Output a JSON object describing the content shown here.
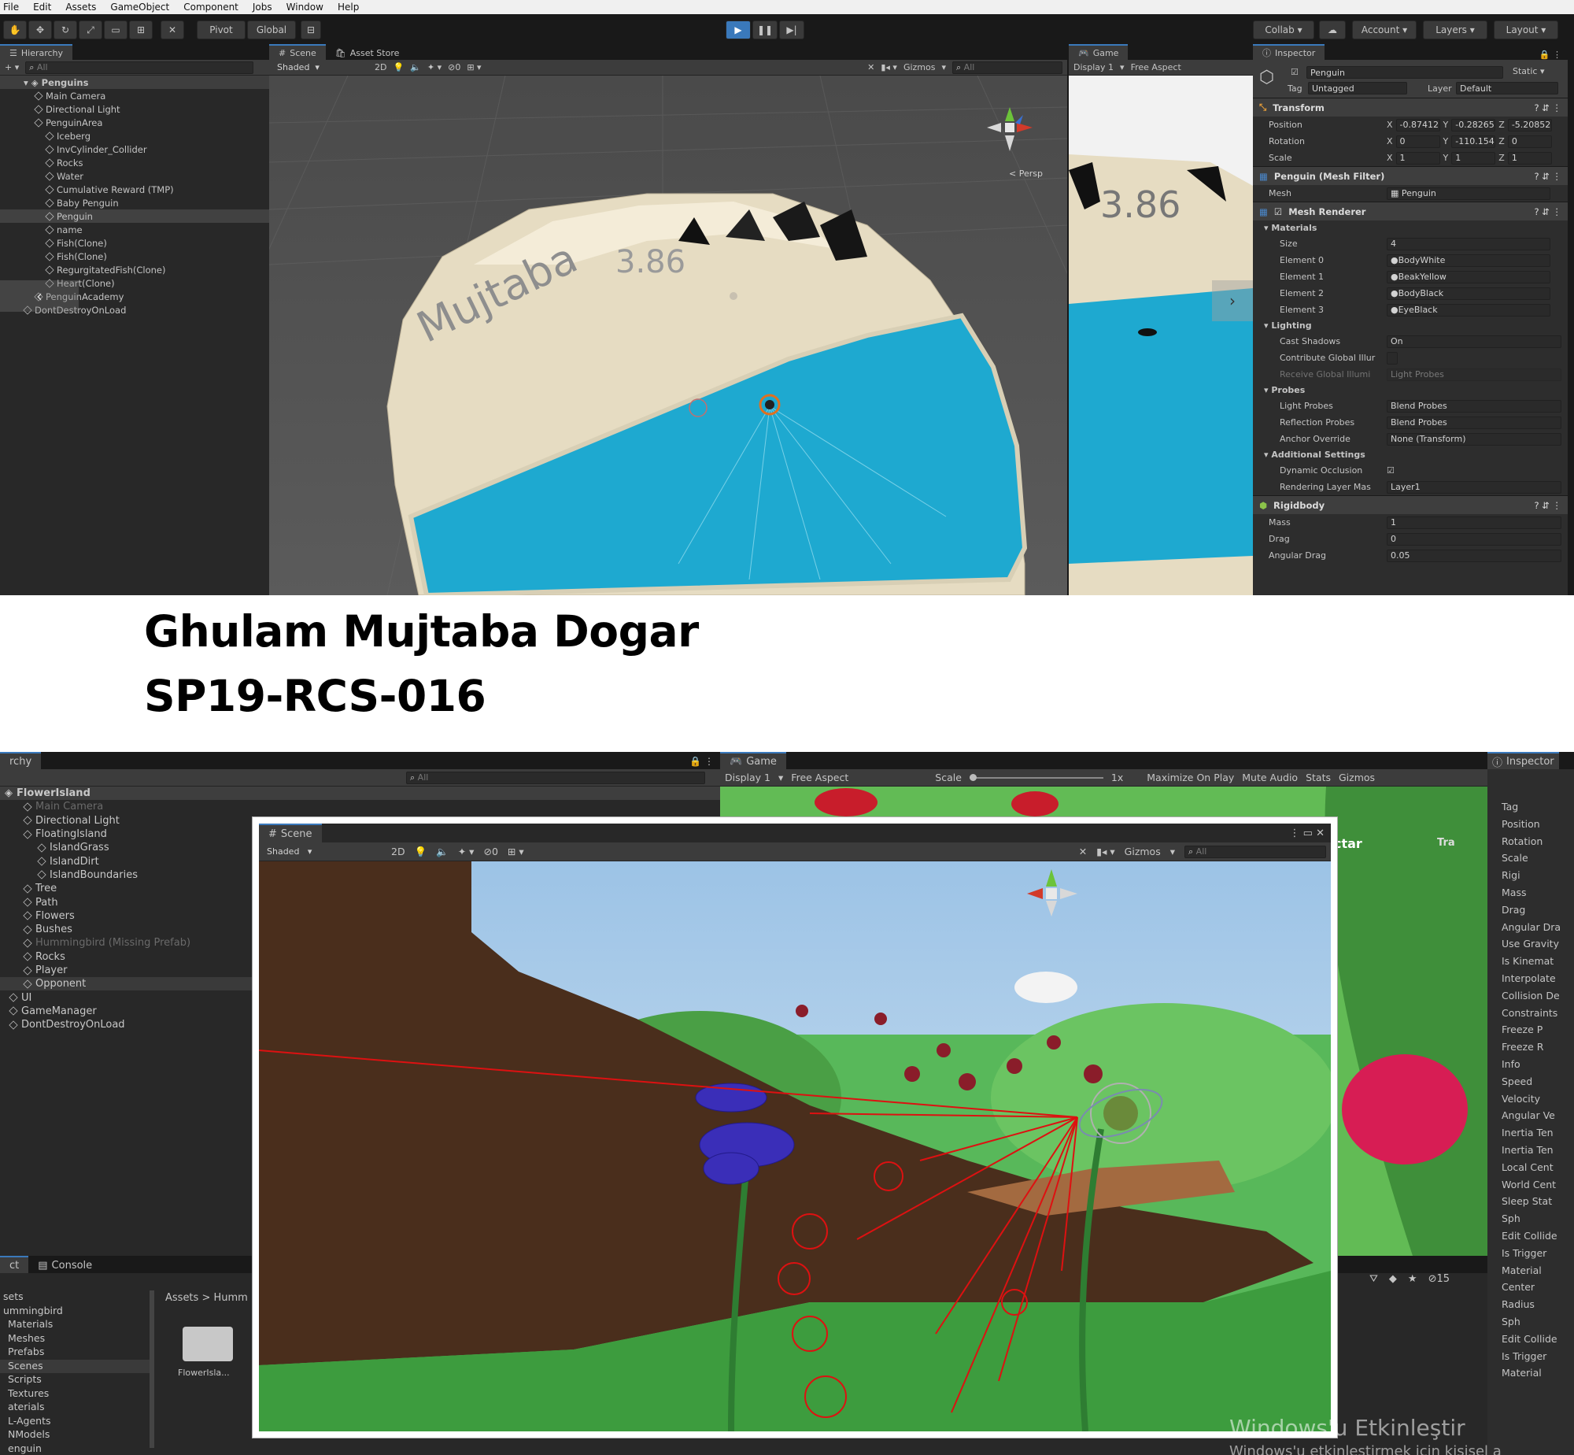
{
  "menu": [
    "File",
    "Edit",
    "Assets",
    "GameObject",
    "Component",
    "Jobs",
    "Window",
    "Help"
  ],
  "toolbar": {
    "pivot": "Pivot",
    "global": "Global",
    "collab": "Collab ▾",
    "account": "Account",
    "layers": "Layers",
    "layout": "Layout"
  },
  "top": {
    "hierarchy": {
      "tab": "Hierarchy",
      "search_placeholder": "All",
      "scene_name": "Penguins",
      "items": [
        {
          "label": "Main Camera",
          "indent": 2
        },
        {
          "label": "Directional Light",
          "indent": 2
        },
        {
          "label": "PenguinArea",
          "indent": 2
        },
        {
          "label": "Iceberg",
          "indent": 3
        },
        {
          "label": "InvCylinder_Collider",
          "indent": 3
        },
        {
          "label": "Rocks",
          "indent": 3
        },
        {
          "label": "Water",
          "indent": 3
        },
        {
          "label": "Cumulative Reward (TMP)",
          "indent": 3
        },
        {
          "label": "Baby Penguin",
          "indent": 3
        },
        {
          "label": "Penguin",
          "indent": 3
        },
        {
          "label": "name",
          "indent": 3
        },
        {
          "label": "Fish(Clone)",
          "indent": 3
        },
        {
          "label": "Fish(Clone)",
          "indent": 3
        },
        {
          "label": "RegurgitatedFish(Clone)",
          "indent": 3
        },
        {
          "label": "Heart(Clone)",
          "indent": 3
        },
        {
          "label": "PenguinAcademy",
          "indent": 2
        },
        {
          "label": "DontDestroyOnLoad",
          "indent": 1
        }
      ]
    },
    "scene": {
      "tab_scene": "Scene",
      "tab_store": "Asset Store",
      "shading": "Shaded",
      "mode_2d": "2D",
      "gizmos": "Gizmos",
      "search_placeholder": "All",
      "persp": "< Persp",
      "name_text": "Mujtaba",
      "reward_text": "3.86"
    },
    "game": {
      "tab": "Game",
      "display": "Display 1",
      "aspect": "Free Aspect",
      "reward_text": "3.86"
    },
    "inspector": {
      "tab": "Inspector",
      "object_name": "Penguin",
      "static_label": "Static ▾",
      "tag_label": "Tag",
      "tag_value": "Untagged",
      "layer_label": "Layer",
      "layer_value": "Default",
      "transform": {
        "title": "Transform",
        "position": {
          "label": "Position",
          "x": "-0.87412",
          "y": "-0.28265",
          "z": "-5.20852"
        },
        "rotation": {
          "label": "Rotation",
          "x": "0",
          "y": "-110.154",
          "z": "0"
        },
        "scale": {
          "label": "Scale",
          "x": "1",
          "y": "1",
          "z": "1"
        }
      },
      "mesh_filter": {
        "title": "Penguin (Mesh Filter)",
        "mesh_label": "Mesh",
        "mesh_value": "Penguin"
      },
      "mesh_renderer": {
        "title": "Mesh Renderer",
        "materials_header": "Materials",
        "size_label": "Size",
        "size_value": "4",
        "elements": [
          {
            "label": "Element 0",
            "value": "BodyWhite"
          },
          {
            "label": "Element 1",
            "value": "BeakYellow"
          },
          {
            "label": "Element 2",
            "value": "BodyBlack"
          },
          {
            "label": "Element 3",
            "value": "EyeBlack"
          }
        ],
        "lighting_header": "Lighting",
        "cast_shadows_label": "Cast Shadows",
        "cast_shadows_value": "On",
        "contribute_gi_label": "Contribute Global Illur",
        "receive_gi_label": "Receive Global Illumi",
        "receive_gi_value": "Light Probes",
        "probes_header": "Probes",
        "light_probes_label": "Light Probes",
        "light_probes_value": "Blend Probes",
        "reflection_probes_label": "Reflection Probes",
        "reflection_probes_value": "Blend Probes",
        "anchor_override_label": "Anchor Override",
        "anchor_override_value": "None (Transform)",
        "additional_header": "Additional Settings",
        "dynamic_occlusion_label": "Dynamic Occlusion",
        "rendering_layer_label": "Rendering Layer Mas",
        "rendering_layer_value": "Layer1"
      },
      "rigidbody": {
        "title": "Rigidbody",
        "mass_label": "Mass",
        "mass_value": "1",
        "drag_label": "Drag",
        "drag_value": "0",
        "angular_drag_label": "Angular Drag",
        "angular_drag_value": "0.05"
      }
    }
  },
  "caption": {
    "name": "Ghulam Mujtaba Dogar",
    "id": "SP19-RCS-016"
  },
  "bottom": {
    "hierarchy": {
      "tab": "rchy",
      "search_placeholder": "All",
      "scene_name": "FlowerIsland",
      "items": [
        {
          "label": "Main Camera",
          "indent": 1,
          "dim": true
        },
        {
          "label": "Directional Light",
          "indent": 1
        },
        {
          "label": "FloatingIsland",
          "indent": 1
        },
        {
          "label": "IslandGrass",
          "indent": 2
        },
        {
          "label": "IslandDirt",
          "indent": 2
        },
        {
          "label": "IslandBoundaries",
          "indent": 2
        },
        {
          "label": "Tree",
          "indent": 1
        },
        {
          "label": "Path",
          "indent": 1
        },
        {
          "label": "Flowers",
          "indent": 1
        },
        {
          "label": "Bushes",
          "indent": 1
        },
        {
          "label": "Hummingbird (Missing Prefab)",
          "indent": 1,
          "dim": true
        },
        {
          "label": "Rocks",
          "indent": 1
        },
        {
          "label": "Player",
          "indent": 1
        },
        {
          "label": "Opponent",
          "indent": 1
        },
        {
          "label": "UI",
          "indent": 0
        },
        {
          "label": "GameManager",
          "indent": 0
        },
        {
          "label": "DontDestroyOnLoad",
          "indent": 0
        }
      ]
    },
    "game": {
      "tab": "Game",
      "display": "Display 1",
      "aspect": "Free Aspect",
      "scale_label": "Scale",
      "scale_value": "1x",
      "maximize": "Maximize On Play",
      "mute": "Mute Audio",
      "stats": "Stats",
      "gizmos": "Gizmos"
    },
    "scene": {
      "tab": "Scene",
      "shading": "Shaded",
      "mode_2d": "2D",
      "gizmos": "Gizmos",
      "search_placeholder": "All"
    },
    "inspector": {
      "tab": "Inspector",
      "labels": [
        "Tag",
        "Position",
        "Rotation",
        "Scale",
        "Rigi",
        "Mass",
        "Drag",
        "Angular Dra",
        "Use Gravity",
        "Is Kinemat",
        "Interpolate",
        "Collision De",
        "Constraints",
        "Freeze P",
        "Freeze R",
        "Info",
        "Speed",
        "Velocity",
        "Angular Ve",
        "Inertia Ten",
        "Inertia Ten",
        "Local Cent",
        "World Cent",
        "Sleep Stat",
        "Sph",
        "Edit Collide",
        "Is Trigger",
        "Material",
        "Center",
        "Radius",
        "Sph",
        "Edit Collide",
        "Is Trigger",
        "Material"
      ]
    },
    "project": {
      "tab_project": "ct",
      "tab_console": "Console",
      "breadcrumb": "Assets > Humm",
      "count": "15",
      "tree": [
        "sets",
        "ummingbird",
        "Materials",
        "Meshes",
        "Prefabs",
        "Scenes",
        "Scripts",
        "Textures",
        "aterials",
        "L-Agents",
        "NModels",
        "enguin"
      ],
      "folder_label": "FlowerIsla..."
    },
    "watermark": {
      "line1": "Windows'u Etkinleştir",
      "line2": "Windows'u etkinleştirmek için kişisel a"
    },
    "tr_label": "Tra",
    "ctar_label": "ctar"
  },
  "colors": {
    "unity_dark": "#282828",
    "water": "#1ea9d0",
    "iceberg": "#e8dfc8",
    "sky": "#b8d4e8",
    "grass": "#3f9b3f",
    "dirt": "#4a2e1c",
    "accent": "#3a79bb"
  }
}
